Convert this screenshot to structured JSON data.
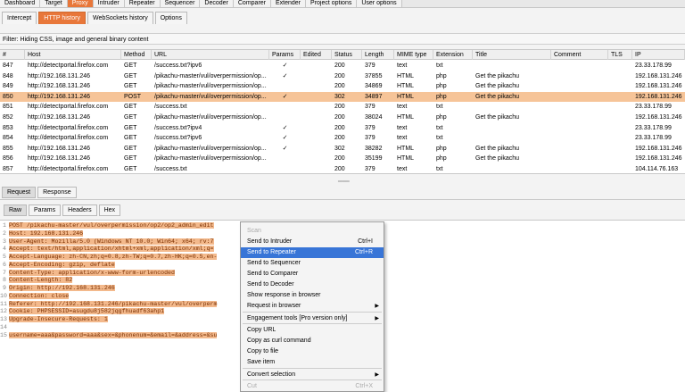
{
  "top_tabs": [
    "Dashboard",
    "Target",
    "Proxy",
    "Intruder",
    "Repeater",
    "Sequencer",
    "Decoder",
    "Comparer",
    "Extender",
    "Project options",
    "User options"
  ],
  "top_active": "Proxy",
  "proxy_tabs": [
    "Intercept",
    "HTTP history",
    "WebSockets history",
    "Options"
  ],
  "proxy_active": "HTTP history",
  "filter_text": "Filter: Hiding CSS, image and general binary content",
  "columns": [
    "#",
    "Host",
    "Method",
    "URL",
    "Params",
    "Edited",
    "Status",
    "Length",
    "MIME type",
    "Extension",
    "Title",
    "Comment",
    "TLS",
    "IP"
  ],
  "rows": [
    {
      "num": "847",
      "host": "http://detectportal.firefox.com",
      "method": "GET",
      "url": "/success.txt?ipv6",
      "params": "✓",
      "status": "200",
      "length": "379",
      "mime": "text",
      "ext": "txt",
      "title": "",
      "ip": "23.33.178.99"
    },
    {
      "num": "848",
      "host": "http://192.168.131.246",
      "method": "GET",
      "url": "/pikachu-master/vul/overpermission/op...",
      "params": "✓",
      "status": "200",
      "length": "37855",
      "mime": "HTML",
      "ext": "php",
      "title": "Get the pikachu",
      "ip": "192.168.131.246"
    },
    {
      "num": "849",
      "host": "http://192.168.131.246",
      "method": "GET",
      "url": "/pikachu-master/vul/overpermission/op...",
      "params": "",
      "status": "200",
      "length": "34869",
      "mime": "HTML",
      "ext": "php",
      "title": "Get the pikachu",
      "ip": "192.168.131.246"
    },
    {
      "num": "850",
      "host": "http://192.168.131.246",
      "method": "POST",
      "url": "/pikachu-master/vul/overpermission/op...",
      "params": "✓",
      "status": "302",
      "length": "34897",
      "mime": "HTML",
      "ext": "php",
      "title": "Get the pikachu",
      "ip": "192.168.131.246",
      "selected": true
    },
    {
      "num": "851",
      "host": "http://detectportal.firefox.com",
      "method": "GET",
      "url": "/success.txt",
      "params": "",
      "status": "200",
      "length": "379",
      "mime": "text",
      "ext": "txt",
      "title": "",
      "ip": "23.33.178.99"
    },
    {
      "num": "852",
      "host": "http://192.168.131.246",
      "method": "GET",
      "url": "/pikachu-master/vul/overpermission/op...",
      "params": "",
      "status": "200",
      "length": "38024",
      "mime": "HTML",
      "ext": "php",
      "title": "Get the pikachu",
      "ip": "192.168.131.246"
    },
    {
      "num": "853",
      "host": "http://detectportal.firefox.com",
      "method": "GET",
      "url": "/success.txt?ipv4",
      "params": "✓",
      "status": "200",
      "length": "379",
      "mime": "text",
      "ext": "txt",
      "title": "",
      "ip": "23.33.178.99"
    },
    {
      "num": "854",
      "host": "http://detectportal.firefox.com",
      "method": "GET",
      "url": "/success.txt?ipv6",
      "params": "✓",
      "status": "200",
      "length": "379",
      "mime": "text",
      "ext": "txt",
      "title": "",
      "ip": "23.33.178.99"
    },
    {
      "num": "855",
      "host": "http://192.168.131.246",
      "method": "GET",
      "url": "/pikachu-master/vul/overpermission/op...",
      "params": "✓",
      "status": "302",
      "length": "38282",
      "mime": "HTML",
      "ext": "php",
      "title": "Get the pikachu",
      "ip": "192.168.131.246"
    },
    {
      "num": "856",
      "host": "http://192.168.131.246",
      "method": "GET",
      "url": "/pikachu-master/vul/overpermission/op...",
      "params": "",
      "status": "200",
      "length": "35199",
      "mime": "HTML",
      "ext": "php",
      "title": "Get the pikachu",
      "ip": "192.168.131.246"
    },
    {
      "num": "857",
      "host": "http://detectportal.firefox.com",
      "method": "GET",
      "url": "/success.txt",
      "params": "",
      "status": "200",
      "length": "379",
      "mime": "text",
      "ext": "txt",
      "title": "",
      "ip": "104.114.76.163"
    }
  ],
  "rr_tabs": [
    "Request",
    "Response"
  ],
  "msg_tabs": [
    "Raw",
    "Params",
    "Headers",
    "Hex"
  ],
  "request_lines": [
    "POST /pikachu-master/vul/overpermission/op2/op2_admin_edit",
    "Host: 192.168.131.246",
    "User-Agent: Mozilla/5.0 (Windows NT 10.0; Win64; x64; rv:7",
    "Accept: text/html,application/xhtml+xml,application/xml;q=",
    "Accept-Language: zh-CN,zh;q=0.8,zh-TW;q=0.7,zh-HK;q=0.5,en-",
    "Accept-Encoding: gzip, deflate",
    "Content-Type: application/x-www-form-urlencoded",
    "Content-Length: 82",
    "Origin: http://192.168.131.246",
    "Connection: close",
    "Referer: http://192.168.131.246/pikachu-master/vul/overperm",
    "Cookie: PHPSESSID=asugdu8j582jqgfhuadf63ahp1",
    "Upgrade-Insecure-Requests: 1",
    "",
    "username=aaa&password=aaa&sex=&phonenum=&email=&address=&su"
  ],
  "context_menu": [
    {
      "label": "Scan",
      "disabled": true
    },
    {
      "label": "Send to Intruder",
      "shortcut": "Ctrl+I"
    },
    {
      "label": "Send to Repeater",
      "shortcut": "Ctrl+R",
      "highlighted": true
    },
    {
      "label": "Send to Sequencer"
    },
    {
      "label": "Send to Comparer"
    },
    {
      "label": "Send to Decoder"
    },
    {
      "label": "Show response in browser"
    },
    {
      "label": "Request in browser",
      "submenu": true
    },
    {
      "label": "Engagement tools [Pro version only]",
      "submenu": true
    },
    {
      "label": "Copy URL"
    },
    {
      "label": "Copy as curl command"
    },
    {
      "label": "Copy to file"
    },
    {
      "label": "Save item"
    },
    {
      "label": "Convert selection",
      "submenu": true
    },
    {
      "label": "Cut",
      "shortcut": "Ctrl+X",
      "disabled": true
    }
  ],
  "colors": {
    "accent": "#e8773a",
    "selected_row": "#f6c498",
    "menu_highlight": "#3875d7"
  }
}
